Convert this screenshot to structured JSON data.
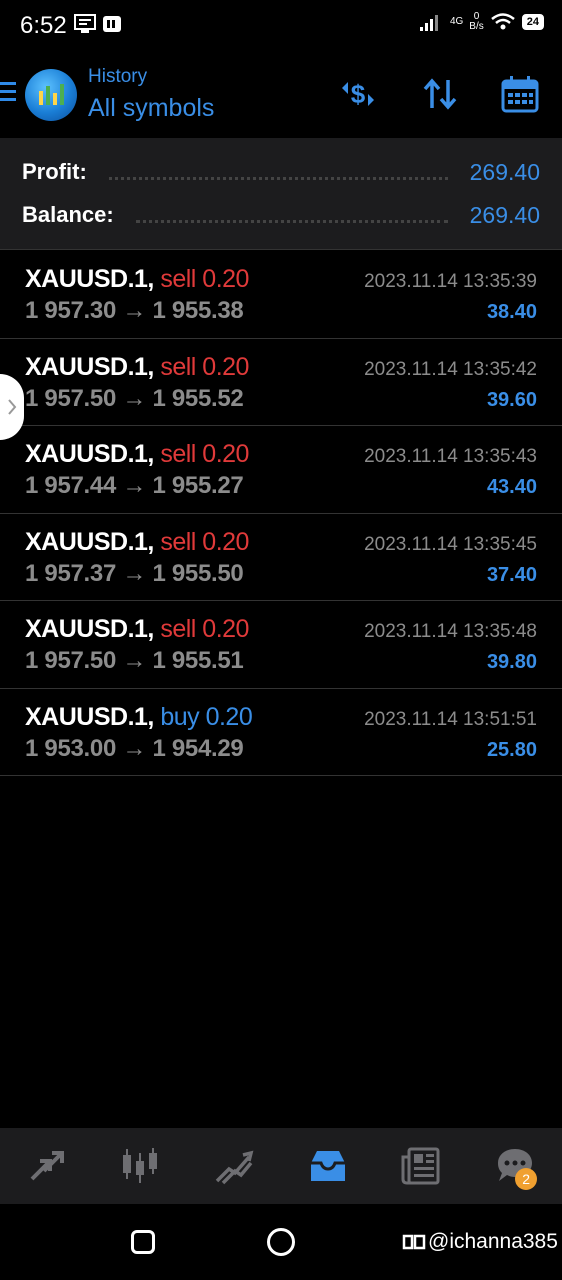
{
  "status_bar": {
    "time": "6:52",
    "network_top": "0",
    "network_bottom": "B/s",
    "signal_label": "4G",
    "battery": "24"
  },
  "header": {
    "subtitle": "History",
    "title": "All symbols"
  },
  "summary": {
    "profit_label": "Profit:",
    "profit_value": "269.40",
    "balance_label": "Balance:",
    "balance_value": "269.40"
  },
  "deals": [
    {
      "symbol": "XAUUSD.1,",
      "type": "sell",
      "lot": "sell 0.20",
      "prices": "1 957.30 → 1 955.38",
      "time": "2023.11.14 13:35:39",
      "profit": "38.40"
    },
    {
      "symbol": "XAUUSD.1,",
      "type": "sell",
      "lot": "sell 0.20",
      "prices": "1 957.50 → 1 955.52",
      "time": "2023.11.14 13:35:42",
      "profit": "39.60"
    },
    {
      "symbol": "XAUUSD.1,",
      "type": "sell",
      "lot": "sell 0.20",
      "prices": "1 957.44 → 1 955.27",
      "time": "2023.11.14 13:35:43",
      "profit": "43.40"
    },
    {
      "symbol": "XAUUSD.1,",
      "type": "sell",
      "lot": "sell 0.20",
      "prices": "1 957.37 → 1 955.50",
      "time": "2023.11.14 13:35:45",
      "profit": "37.40"
    },
    {
      "symbol": "XAUUSD.1,",
      "type": "sell",
      "lot": "sell 0.20",
      "prices": "1 957.50 → 1 955.51",
      "time": "2023.11.14 13:35:48",
      "profit": "39.80"
    },
    {
      "symbol": "XAUUSD.1,",
      "type": "buy",
      "lot": "buy 0.20",
      "prices": "1 953.00 → 1 954.29",
      "time": "2023.11.14 13:51:51",
      "profit": "25.80"
    }
  ],
  "bottom_nav": {
    "items": [
      "quotes-icon",
      "chart-icon",
      "trade-icon",
      "history-icon",
      "news-icon",
      "chat-icon"
    ],
    "active": "history-icon",
    "chat_badge": "2"
  },
  "watermark": "@ichanna385",
  "colors": {
    "accent": "#3a8ee6",
    "sell": "#e03a3a",
    "buy": "#3a8ee6",
    "muted": "#8c8c8c"
  }
}
